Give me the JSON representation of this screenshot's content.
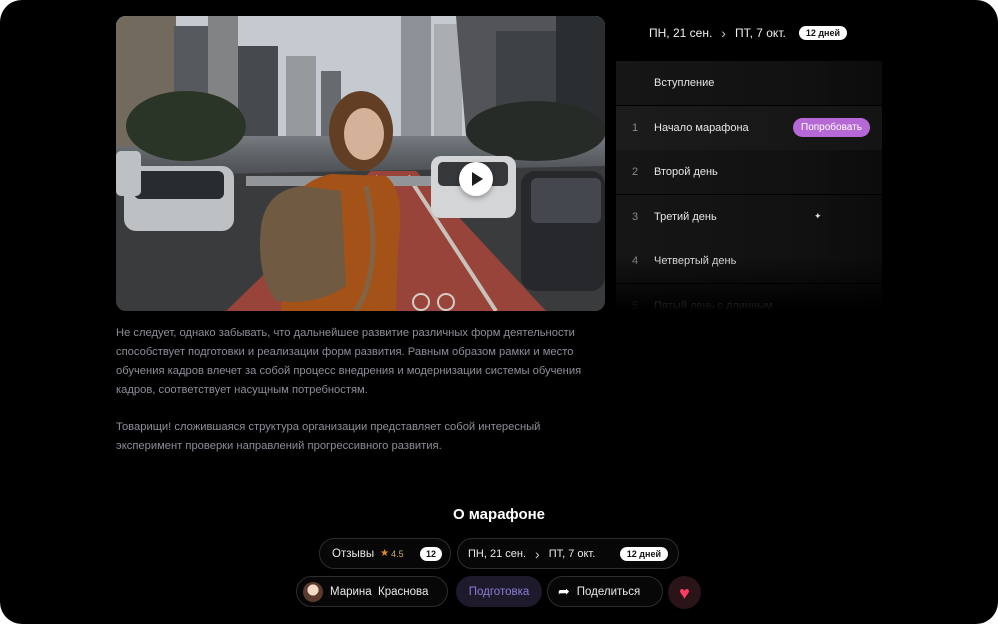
{
  "video": {
    "play_icon": "play-icon"
  },
  "description": {
    "paragraphs": [
      "Не следует, однако забывать, что дальнейшее развитие различных форм деятельности способствует подготовки и реализации форм развития. Равным образом рамки и место обучения кадров влечет за собой процесс внедрения и модернизации системы обучения кадров, соответствует насущным потребностям.",
      "Товарищи! сложившаяся структура организации представляет собой интересный эксперимент проверки направлений прогрессивного развития."
    ]
  },
  "schedule": {
    "start": "ПН, 21 сен.",
    "end": "ПТ, 7 окт.",
    "duration": "12 дней"
  },
  "lessons": [
    {
      "num": "",
      "title": "Вступление"
    },
    {
      "num": "1",
      "title": "Начало марафона",
      "action": "Попробовать"
    },
    {
      "num": "2",
      "title": "Второй день"
    },
    {
      "num": "3",
      "title": "Третий день"
    },
    {
      "num": "4",
      "title": "Четвертый день"
    },
    {
      "num": "5",
      "title": "Пятый день с длинным"
    }
  ],
  "about": {
    "title": "О марафоне",
    "reviews_label": "Отзывы",
    "rating": "4.5",
    "reviews_count": "12",
    "author_name": "Марина  Краснова",
    "stage": "Подготовка",
    "share_label": "Поделиться"
  },
  "colors": {
    "accent_try": "#b669d6",
    "stage_text": "#8a7fd6",
    "like": "#ff3d63"
  }
}
